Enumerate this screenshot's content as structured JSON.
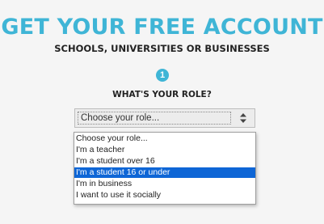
{
  "headline": "GET YOUR FREE ACCOUNT",
  "subheadline": "SCHOOLS, UNIVERSITIES OR BUSINESSES",
  "step": {
    "number": "1",
    "question": "WHAT'S YOUR ROLE?"
  },
  "role_select": {
    "value": "Choose your role...",
    "arrow_icon": "up-down-arrows-icon",
    "options": [
      "Choose your role...",
      "I'm a teacher",
      "I'm a student over 16",
      "I'm a student 16 or under",
      "I'm in business",
      "I want to use it socially"
    ],
    "highlighted_option": "I'm a student 16 or under"
  },
  "colors": {
    "accent": "#3fb5d6",
    "highlight": "#0e66d6"
  }
}
